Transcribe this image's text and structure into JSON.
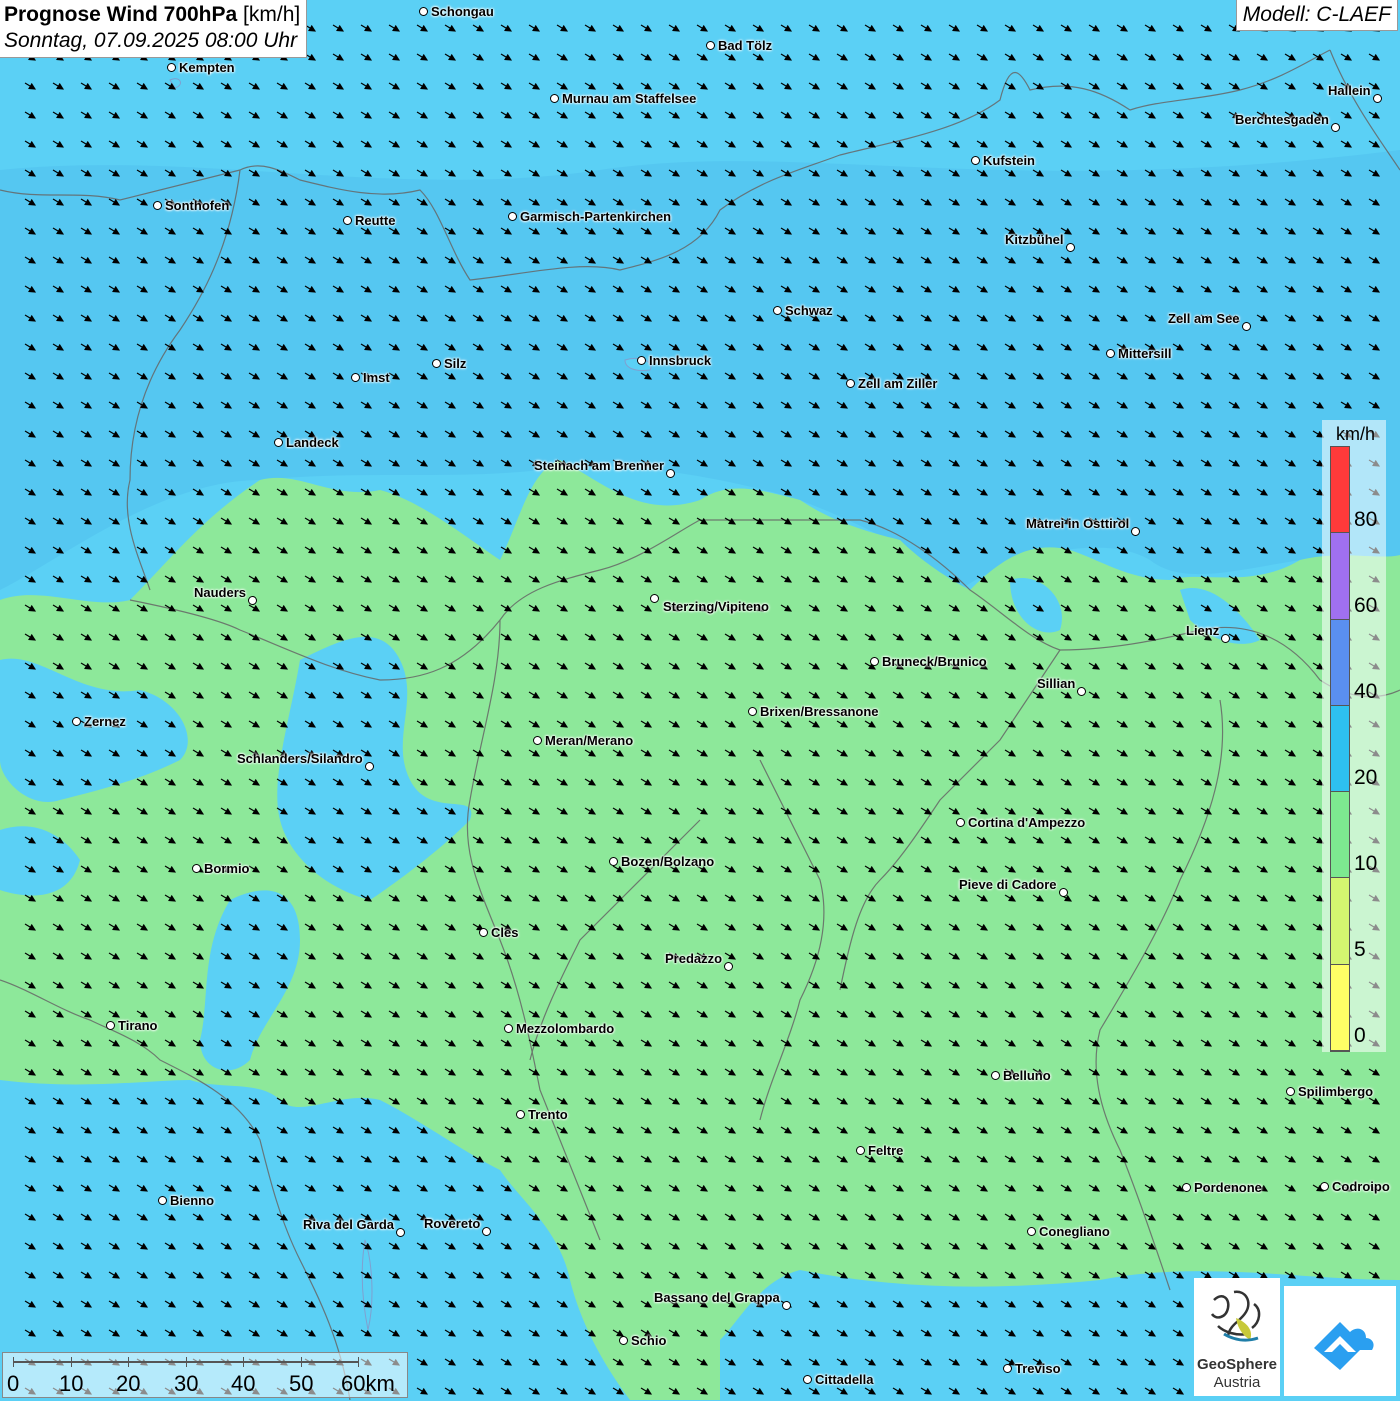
{
  "header": {
    "title_bold": "Prognose Wind 700hPa",
    "title_unit": "[km/h]",
    "subtitle": "Sonntag, 07.09.2025 08:00 Uhr",
    "model": "Modell: C-LAEF"
  },
  "legend": {
    "unit": "km/h",
    "ticks": [
      "80",
      "60",
      "40",
      "20",
      "10",
      "5",
      "0"
    ],
    "colors_top_to_bottom": [
      "#ff3a3a",
      "#a070f0",
      "#5a8ff0",
      "#2ec0f0",
      "#7de890",
      "#d4f570",
      "#ffff66"
    ]
  },
  "colors": {
    "wind_10_20": "#5bd0f5",
    "wind_5_10": "#8de89a",
    "borders": "#666666"
  },
  "cities": [
    {
      "name": "Schongau"
    },
    {
      "name": "Bad Tölz"
    },
    {
      "name": "Kempten"
    },
    {
      "name": "Murnau am Staffelsee"
    },
    {
      "name": "Hallein"
    },
    {
      "name": "Berchtesgaden"
    },
    {
      "name": "Kufstein"
    },
    {
      "name": "Sonthofen"
    },
    {
      "name": "Reutte"
    },
    {
      "name": "Garmisch-Partenkirchen"
    },
    {
      "name": "Kitzbühel"
    },
    {
      "name": "Schwaz"
    },
    {
      "name": "Zell am See"
    },
    {
      "name": "Mittersill"
    },
    {
      "name": "Innsbruck"
    },
    {
      "name": "Silz"
    },
    {
      "name": "Imst"
    },
    {
      "name": "Zell am Ziller"
    },
    {
      "name": "Landeck"
    },
    {
      "name": "Steinach am Brenner"
    },
    {
      "name": "Matrei in Osttirol"
    },
    {
      "name": "Nauders"
    },
    {
      "name": "Sterzing/Vipiteno"
    },
    {
      "name": "Lienz"
    },
    {
      "name": "Bruneck/Brunico"
    },
    {
      "name": "Sillian"
    },
    {
      "name": "Zernez"
    },
    {
      "name": "Brixen/Bressanone"
    },
    {
      "name": "Meran/Merano"
    },
    {
      "name": "Schlanders/Silandro"
    },
    {
      "name": "Cortina d'Ampezzo"
    },
    {
      "name": "Bozen/Bolzano"
    },
    {
      "name": "Bormio"
    },
    {
      "name": "Pieve di Cadore"
    },
    {
      "name": "Cles"
    },
    {
      "name": "Predazzo"
    },
    {
      "name": "Tirano"
    },
    {
      "name": "Mezzolombardo"
    },
    {
      "name": "Belluno"
    },
    {
      "name": "Spilimbergo"
    },
    {
      "name": "Trento"
    },
    {
      "name": "Feltre"
    },
    {
      "name": "Bienno"
    },
    {
      "name": "Pordenone"
    },
    {
      "name": "Codroipo"
    },
    {
      "name": "Riva del Garda"
    },
    {
      "name": "Rovereto"
    },
    {
      "name": "Conegliano"
    },
    {
      "name": "Bassano del Grappa"
    },
    {
      "name": "Schio"
    },
    {
      "name": "Treviso"
    },
    {
      "name": "Cittadella"
    }
  ],
  "scalebar": {
    "labels": [
      "0",
      "10",
      "20",
      "30",
      "40",
      "50",
      "60km"
    ]
  },
  "logos": {
    "geosphere_line1": "GeoSphere",
    "geosphere_line2": "Austria"
  }
}
